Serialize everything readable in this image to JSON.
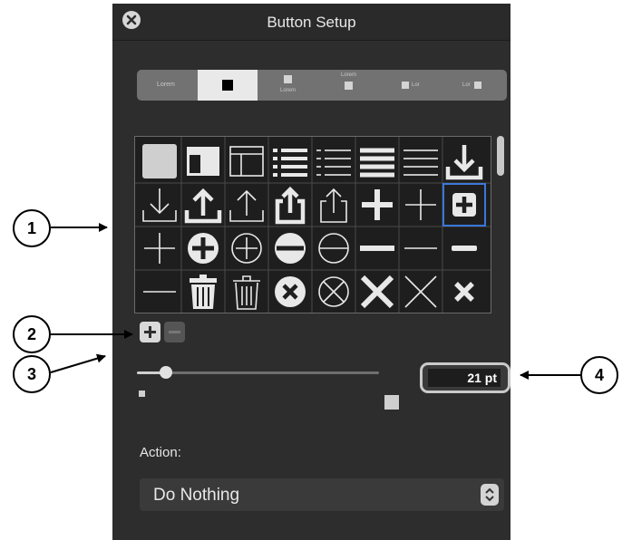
{
  "window": {
    "title": "Button Setup"
  },
  "style_segments": [
    {
      "label": "Lorem",
      "selected": false
    },
    {
      "label": "",
      "selected": true
    },
    {
      "label": "Lorem",
      "selected": false
    },
    {
      "label": "Lorem",
      "selected": false
    },
    {
      "label": "Lor",
      "selected": false
    },
    {
      "label": "Lor",
      "selected": false
    }
  ],
  "icon_grid": {
    "rows": [
      [
        "square-icon",
        "layout-header-icon",
        "layout-window-icon",
        "list-bullets-bold-icon",
        "list-bullets-thin-icon",
        "lines-bold-icon",
        "lines-thin-icon",
        "download-bold-icon"
      ],
      [
        "download-thin-icon",
        "upload-bold-icon",
        "upload-thin-icon",
        "share-bold-icon",
        "share-thin-icon",
        "plus-bold-icon",
        "plus-thin-icon",
        "plus-square-icon"
      ],
      [
        "plus-thin-icon",
        "plus-circle-bold-icon",
        "plus-circle-thin-icon",
        "minus-circle-bold-icon",
        "minus-circle-thin-icon",
        "minus-bold-icon",
        "minus-thin-icon",
        "minus-small-icon"
      ],
      [
        "minus-thin-icon",
        "trash-bold-icon",
        "trash-thin-icon",
        "x-circle-bold-icon",
        "x-circle-thin-icon",
        "x-bold-icon",
        "x-thin-icon",
        "x-small-icon"
      ]
    ],
    "selected_row": 1,
    "selected_col": 7
  },
  "controls": {
    "add_icon": "plus-icon",
    "remove_icon": "minus-icon"
  },
  "size_slider": {
    "value_fraction": 0.12
  },
  "size_field": {
    "value": "21 pt"
  },
  "action": {
    "label": "Action:",
    "value": "Do Nothing"
  },
  "callouts": {
    "c1": "1",
    "c2": "2",
    "c3": "3",
    "c4": "4"
  },
  "colors": {
    "panel": "#2d2d2d",
    "selection": "#3a78d8",
    "icon": "#e8e8e8"
  }
}
